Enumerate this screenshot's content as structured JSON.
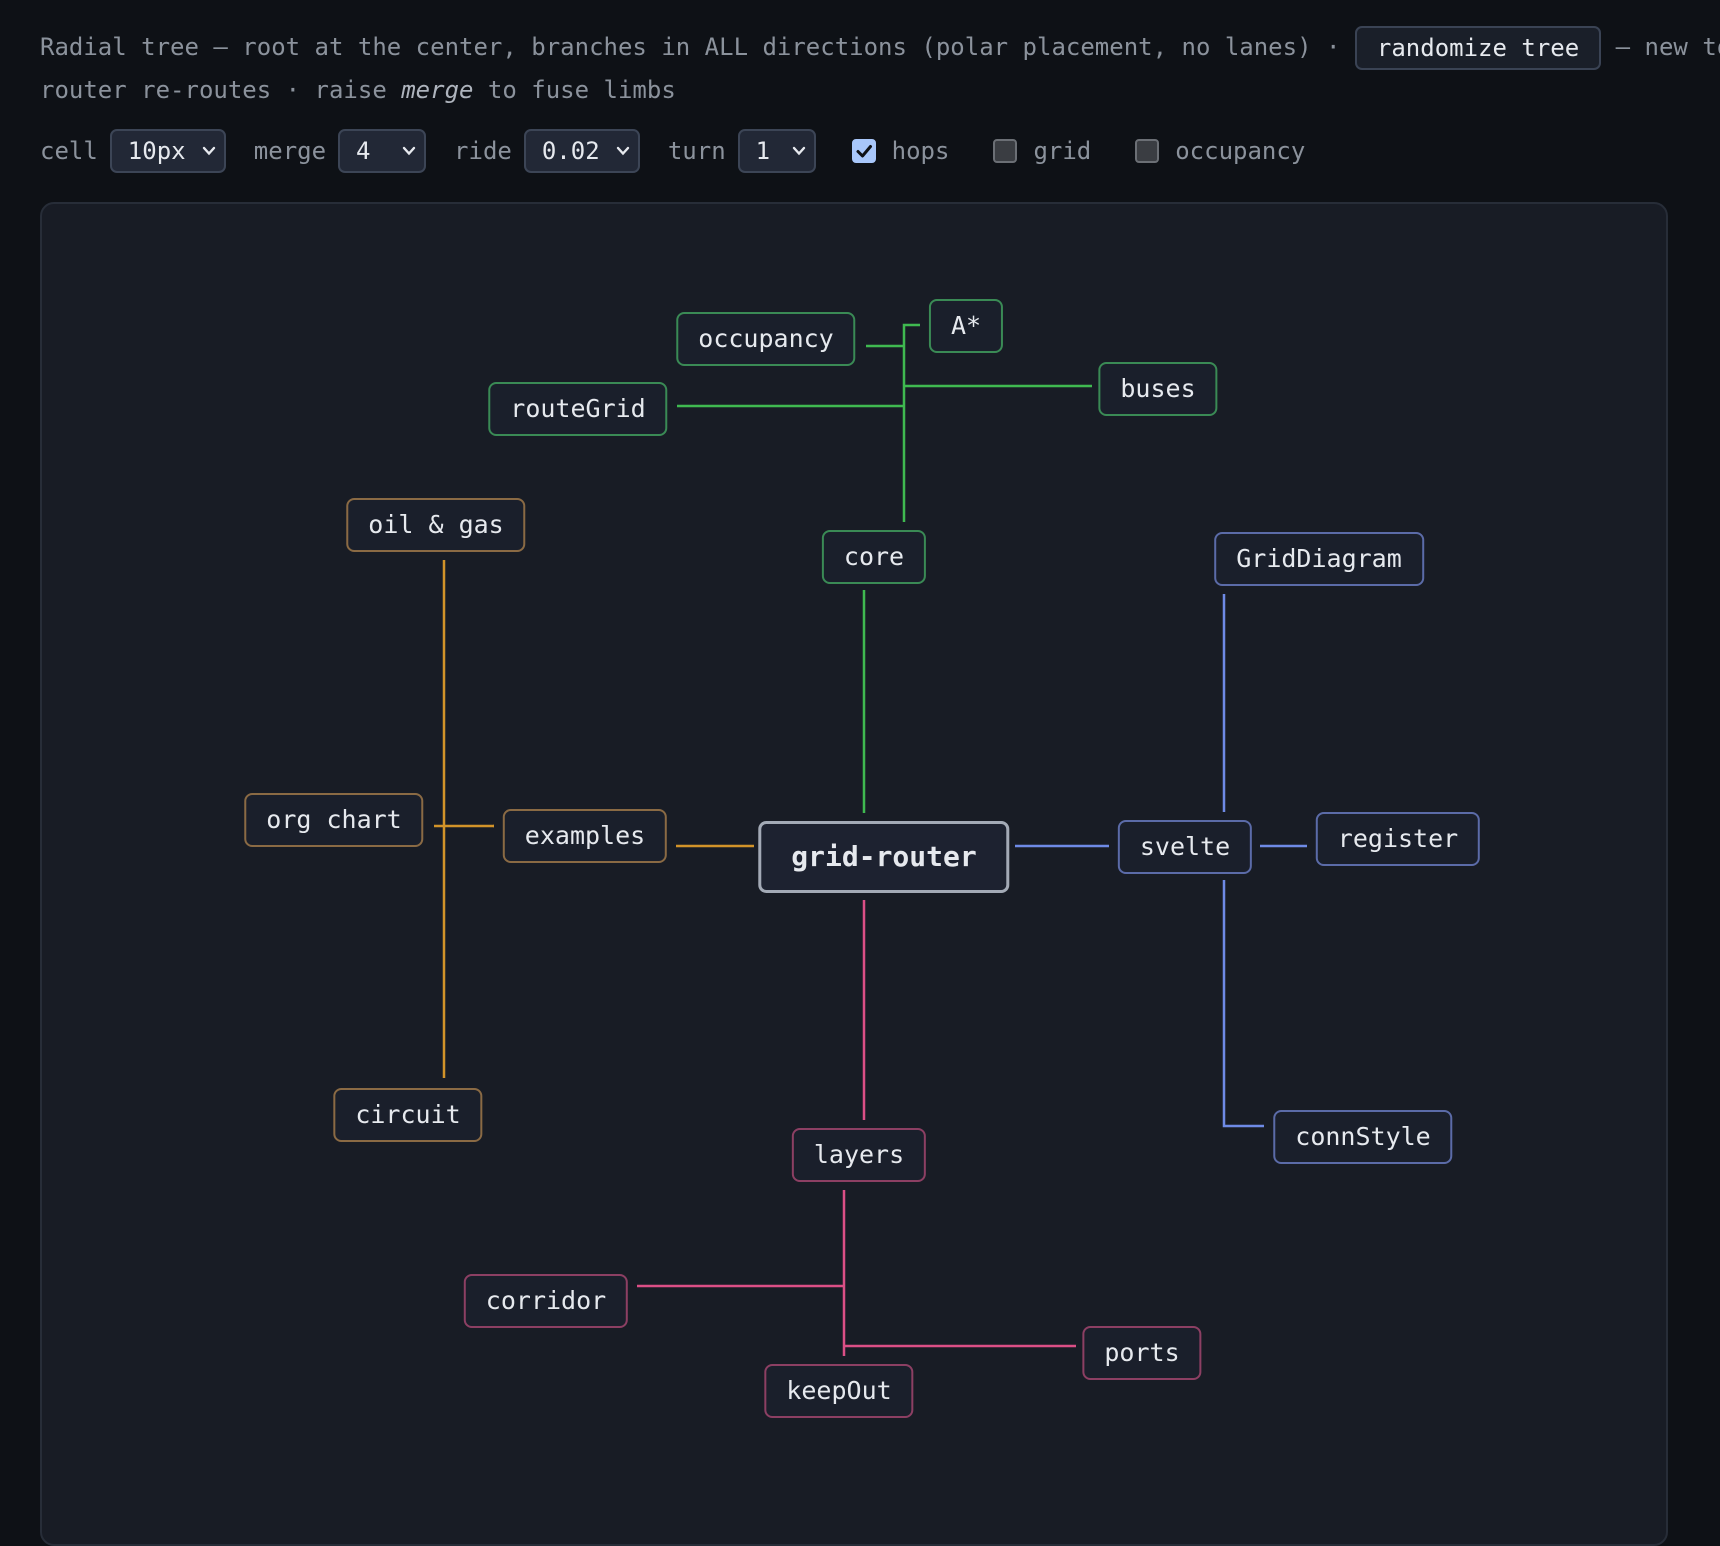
{
  "intro": {
    "line1_text": "Radial tree — root at the center, branches in ALL directions (polar placement, no lanes) · ",
    "button_label": "randomize tree",
    "line1_tail": " — new to",
    "line2_a": "router re-routes · raise ",
    "line2_em": "merge",
    "line2_b": " to fuse limbs"
  },
  "controls": {
    "cell": {
      "label": "cell",
      "value": "10px"
    },
    "merge": {
      "label": "merge",
      "value": "4"
    },
    "ride": {
      "label": "ride",
      "value": "0.02"
    },
    "turn": {
      "label": "turn",
      "value": "1"
    },
    "hops": {
      "label": "hops",
      "checked": true
    },
    "grid": {
      "label": "grid",
      "checked": false
    },
    "occupancy": {
      "label": "occupancy",
      "checked": false
    }
  },
  "colors": {
    "core_branch": "#3fb950",
    "examples_branch": "#d29329",
    "svelte_branch": "#6e8ae6",
    "layers_branch": "#db4f86"
  },
  "tree": {
    "root": "grid-router",
    "core": "core",
    "occupancy": "occupancy",
    "astar": "A*",
    "buses": "buses",
    "routeGrid": "routeGrid",
    "examples": "examples",
    "oil_gas": "oil & gas",
    "org_chart": "org chart",
    "circuit": "circuit",
    "svelte": "svelte",
    "GridDiagram": "GridDiagram",
    "register": "register",
    "connStyle": "connStyle",
    "layers": "layers",
    "corridor": "corridor",
    "keepOut": "keepOut",
    "ports": "ports"
  }
}
